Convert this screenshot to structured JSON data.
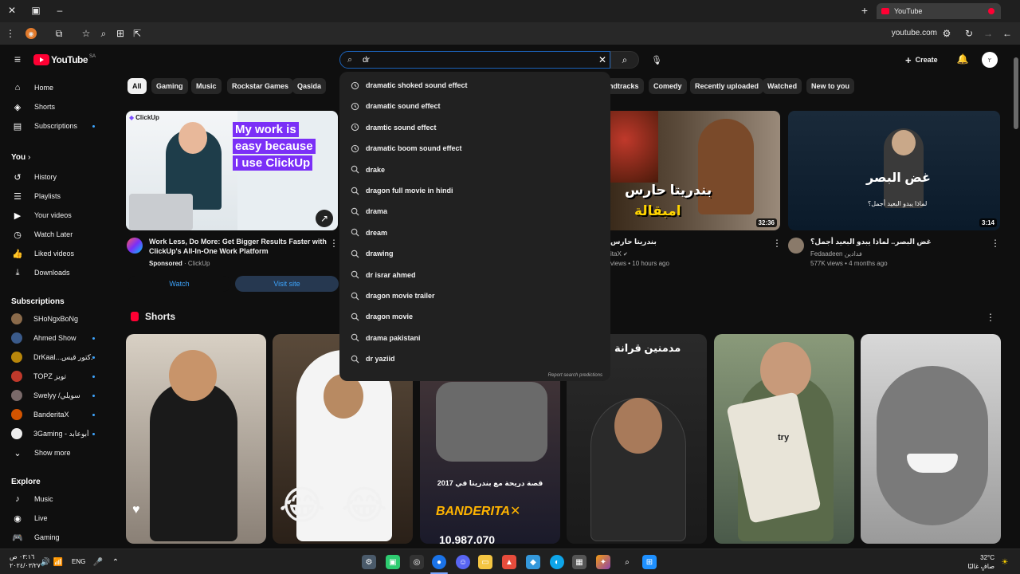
{
  "browser": {
    "tab_title": "YouTube",
    "url": "youtube.com"
  },
  "header": {
    "logo_text": "YouTube",
    "country_code": "SA",
    "search_value": "dr",
    "create_label": "Create",
    "avatar_text": "٢"
  },
  "suggestions": [
    {
      "icon": "history-icon",
      "text": "dramatic shoked sound effect"
    },
    {
      "icon": "history-icon",
      "text": "dramatic sound effect"
    },
    {
      "icon": "history-icon",
      "text": "dramtic sound effect"
    },
    {
      "icon": "history-icon",
      "text": "dramatic boom sound effect"
    },
    {
      "icon": "search-icon",
      "text": "drake"
    },
    {
      "icon": "search-icon",
      "text": "dragon full movie in hindi"
    },
    {
      "icon": "search-icon",
      "text": "drama"
    },
    {
      "icon": "search-icon",
      "text": "dream"
    },
    {
      "icon": "search-icon",
      "text": "drawing"
    },
    {
      "icon": "search-icon",
      "text": "dr israr ahmed"
    },
    {
      "icon": "search-icon",
      "text": "dragon movie trailer"
    },
    {
      "icon": "search-icon",
      "text": "dragon movie"
    },
    {
      "icon": "search-icon",
      "text": "drama pakistani"
    },
    {
      "icon": "search-icon",
      "text": "dr yaziid"
    }
  ],
  "report_predictions": "Report search predictions",
  "sidebar": {
    "main": [
      {
        "label": "Home",
        "icon": "home-icon"
      },
      {
        "label": "Shorts",
        "icon": "shorts-icon"
      },
      {
        "label": "Subscriptions",
        "icon": "subscriptions-icon"
      }
    ],
    "you_heading": "You",
    "you": [
      {
        "label": "History",
        "icon": "history-icon"
      },
      {
        "label": "Playlists",
        "icon": "playlists-icon"
      },
      {
        "label": "Your videos",
        "icon": "your-videos-icon"
      },
      {
        "label": "Watch Later",
        "icon": "watch-later-icon"
      },
      {
        "label": "Liked videos",
        "icon": "liked-icon"
      },
      {
        "label": "Downloads",
        "icon": "download-icon"
      }
    ],
    "subscriptions_heading": "Subscriptions",
    "subscriptions": [
      {
        "label": "SHoNgxBoNg",
        "color": "#8a6a4a"
      },
      {
        "label": "Ahmed Show",
        "color": "#3a5a8a"
      },
      {
        "label": "DrKaal...دكتور قيس",
        "color": "#b8860b"
      },
      {
        "label": "TOPZ تويز",
        "color": "#c0392b"
      },
      {
        "label": "Swelyy /سويلي",
        "color": "#7a6a6a"
      },
      {
        "label": "BanderitaX",
        "color": "#d35400"
      },
      {
        "label": "3Gaming - أبوعابد",
        "color": "#eeeeee"
      }
    ],
    "show_more": "Show more",
    "explore_heading": "Explore",
    "explore": [
      {
        "label": "Music",
        "icon": "music-icon"
      },
      {
        "label": "Live",
        "icon": "live-icon"
      },
      {
        "label": "Gaming",
        "icon": "gaming-icon"
      }
    ]
  },
  "chips": [
    "All",
    "Gaming",
    "Music",
    "Rockstar Games",
    "Qasida",
    "ndtracks",
    "Comedy",
    "Recently uploaded",
    "Watched",
    "New to you"
  ],
  "ad": {
    "brand": "ClickUp",
    "headline_lines": [
      "My work is",
      "easy because",
      "I use ClickUp"
    ],
    "title": "Work Less, Do More: Get Bigger Results Faster with ClickUp's All-In-One Work Platform",
    "sponsored": "Sponsored",
    "advertiser": "· ClickUp",
    "watch_label": "Watch",
    "visit_label": "Visit site"
  },
  "videos": [
    {
      "thumb_text_1": "بندريتا حارس",
      "thumb_text_2": "امبقالة",
      "duration": "32:36",
      "title": "بندريتا حارس",
      "channel": "itaX",
      "meta": "views • 10 hours ago"
    },
    {
      "thumb_text_1": "غض البصر",
      "thumb_text_2": "لماذا يبدو البعيد أجمل؟",
      "duration": "3:14",
      "title": "غض البصر.. لماذا يبدو البعيد أجمل؟",
      "channel": "Fedaadeen فدادين",
      "meta": "577K views • 4 months ago"
    }
  ],
  "shorts": {
    "heading": "Shorts",
    "items": [
      {
        "overlay": ""
      },
      {
        "overlay": ""
      },
      {
        "overlay": "قصة دريحة مع بندريتا في 2017",
        "count": "10,987,070"
      },
      {
        "overlay": "مدمنين قرانة"
      },
      {
        "overlay": "try"
      },
      {
        "overlay": ""
      }
    ]
  },
  "taskbar": {
    "time": "٠٣:١٦ ص",
    "date": "٢٠٢٤/٠٣/٢٧",
    "lang": "ENG",
    "weather_temp": "32°C",
    "weather_desc": "صافٍ غالبًا"
  }
}
